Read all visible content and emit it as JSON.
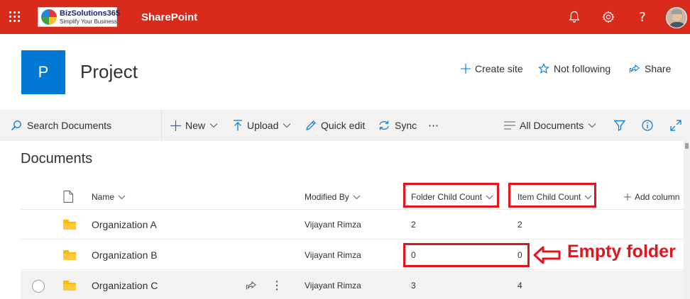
{
  "suite_bar": {
    "brand_color": "#d92b1c",
    "logo": {
      "name": "BizSolutions365",
      "tagline": "Simplify Your Business"
    },
    "app_name": "SharePoint",
    "icons": [
      "waffle-icon",
      "bell-icon",
      "gear-icon",
      "help-icon",
      "avatar"
    ]
  },
  "site": {
    "logo_letter": "P",
    "logo_color": "#0078d4",
    "title": "Project",
    "actions": [
      {
        "label": "Create site",
        "icon": "plus-icon"
      },
      {
        "label": "Not following",
        "icon": "star-icon"
      },
      {
        "label": "Share",
        "icon": "share-icon"
      }
    ]
  },
  "command_bar": {
    "search_placeholder": "Search Documents",
    "commands": [
      {
        "label": "New",
        "icon": "plus-icon",
        "has_dropdown": true
      },
      {
        "label": "Upload",
        "icon": "upload-icon",
        "has_dropdown": true
      },
      {
        "label": "Quick edit",
        "icon": "pencil-icon",
        "has_dropdown": false
      },
      {
        "label": "Sync",
        "icon": "sync-icon",
        "has_dropdown": false
      }
    ],
    "view_label": "All Documents",
    "right_icons": [
      "filter-icon",
      "info-icon",
      "expand-icon"
    ]
  },
  "documents": {
    "title": "Documents",
    "columns": {
      "name": "Name",
      "modified_by": "Modified By",
      "folder_child_count": "Folder Child Count",
      "item_child_count": "Item Child Count",
      "add_column": "Add column"
    },
    "rows": [
      {
        "name": "Organization A",
        "modified_by": "Vijayant Rimza",
        "folder_child_count": "2",
        "item_child_count": "2"
      },
      {
        "name": "Organization B",
        "modified_by": "Vijayant Rimza",
        "folder_child_count": "0",
        "item_child_count": "0"
      },
      {
        "name": "Organization C",
        "modified_by": "Vijayant Rimza",
        "folder_child_count": "3",
        "item_child_count": "4"
      }
    ]
  },
  "annotation": {
    "label": "Empty folder",
    "color": "#e3141c"
  }
}
